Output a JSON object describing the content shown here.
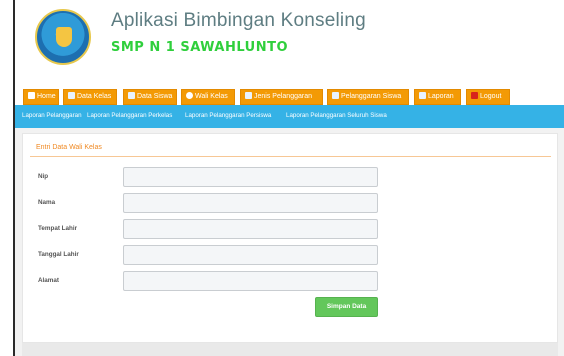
{
  "header": {
    "app_title": "Aplikasi Bimbingan Konseling",
    "school_name": "SMP N 1 SAWAHLUNTO",
    "logo_icon": "tut-wuri-handayani-logo"
  },
  "menu": {
    "items": [
      {
        "label": "Home",
        "icon": "home-icon"
      },
      {
        "label": "Data Kelas",
        "icon": "data-icon"
      },
      {
        "label": "Data Siswa",
        "icon": "data-icon"
      },
      {
        "label": "Wali Kelas",
        "icon": "user-icon"
      },
      {
        "label": "Jenis Pelanggaran",
        "icon": "data-icon"
      },
      {
        "label": "Pelanggaran Siswa",
        "icon": "data-icon"
      },
      {
        "label": "Laporan",
        "icon": "data-icon"
      },
      {
        "label": "Logout",
        "icon": "close-icon"
      }
    ],
    "color": "#f39a05"
  },
  "subnav": {
    "items": [
      {
        "label": "Laporan Pelanggaran"
      },
      {
        "label": "Laporan Pelanggaran Perkelas"
      },
      {
        "label": "Laporan Pelanggaran Persiswa"
      },
      {
        "label": "Laporan Pelanggaran Seluruh Siswa"
      }
    ],
    "color": "#35b2e6"
  },
  "form": {
    "title": "Entri Data Wali Kelas",
    "fields": [
      {
        "label": "Nip",
        "value": ""
      },
      {
        "label": "Nama",
        "value": ""
      },
      {
        "label": "Tempat Lahir",
        "value": ""
      },
      {
        "label": "Tanggal Lahir",
        "value": ""
      },
      {
        "label": "Alamat",
        "value": ""
      }
    ],
    "submit_label": "Simpan Data",
    "submit_color": "#63c75b"
  }
}
